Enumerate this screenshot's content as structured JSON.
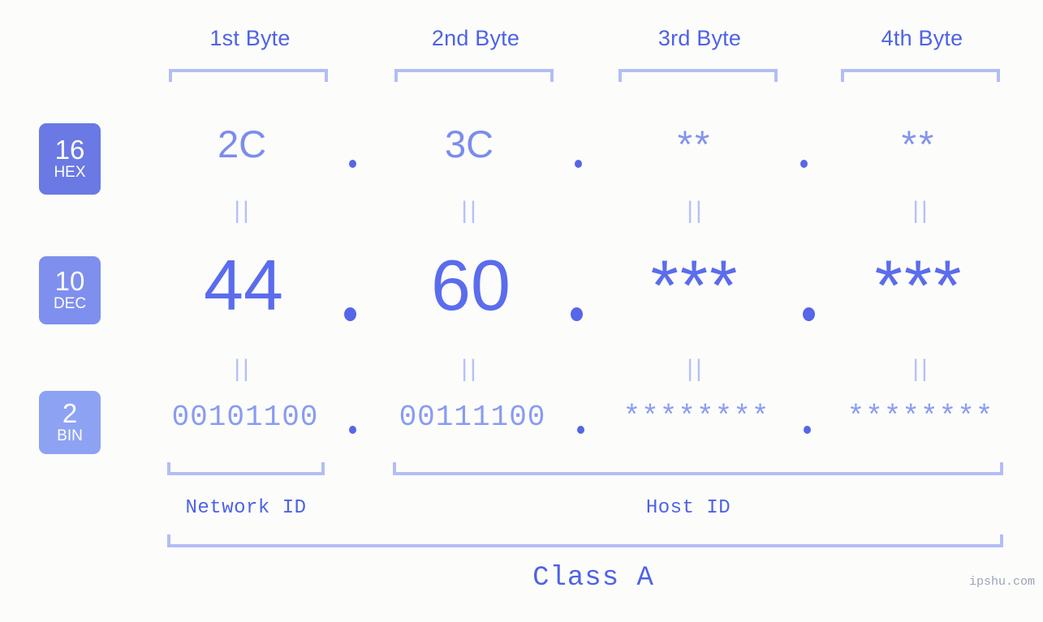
{
  "meta": {
    "background_color": "#fcfdfa",
    "accent_color": "#4e62e8",
    "value_color": "#7b8cef",
    "bracket_color": "#b3bdf7",
    "watermark": "ipshu.com"
  },
  "byte_headers": [
    {
      "label": "1st Byte"
    },
    {
      "label": "2nd Byte"
    },
    {
      "label": "3rd Byte"
    },
    {
      "label": "4th Byte"
    }
  ],
  "radix_badges": [
    {
      "number": "16",
      "name": "HEX",
      "color": "#6a79e3"
    },
    {
      "number": "10",
      "name": "DEC",
      "color": "#7e8fee"
    },
    {
      "number": "2",
      "name": "BIN",
      "color": "#8ea2f4"
    }
  ],
  "rows": {
    "hex": {
      "radix": "16",
      "radix_name": "HEX",
      "values": [
        "2C",
        "3C",
        "**",
        "**"
      ],
      "separator": "."
    },
    "dec": {
      "radix": "10",
      "radix_name": "DEC",
      "values": [
        "44",
        "60",
        "***",
        "***"
      ],
      "separator": "."
    },
    "bin": {
      "radix": "2",
      "radix_name": "BIN",
      "values": [
        "00101100",
        "00111100",
        "********",
        "********"
      ],
      "separator": "."
    }
  },
  "equals_marker": "||",
  "sections": [
    {
      "label": "Network ID"
    },
    {
      "label": "Host ID"
    }
  ],
  "class": {
    "label": "Class A"
  }
}
